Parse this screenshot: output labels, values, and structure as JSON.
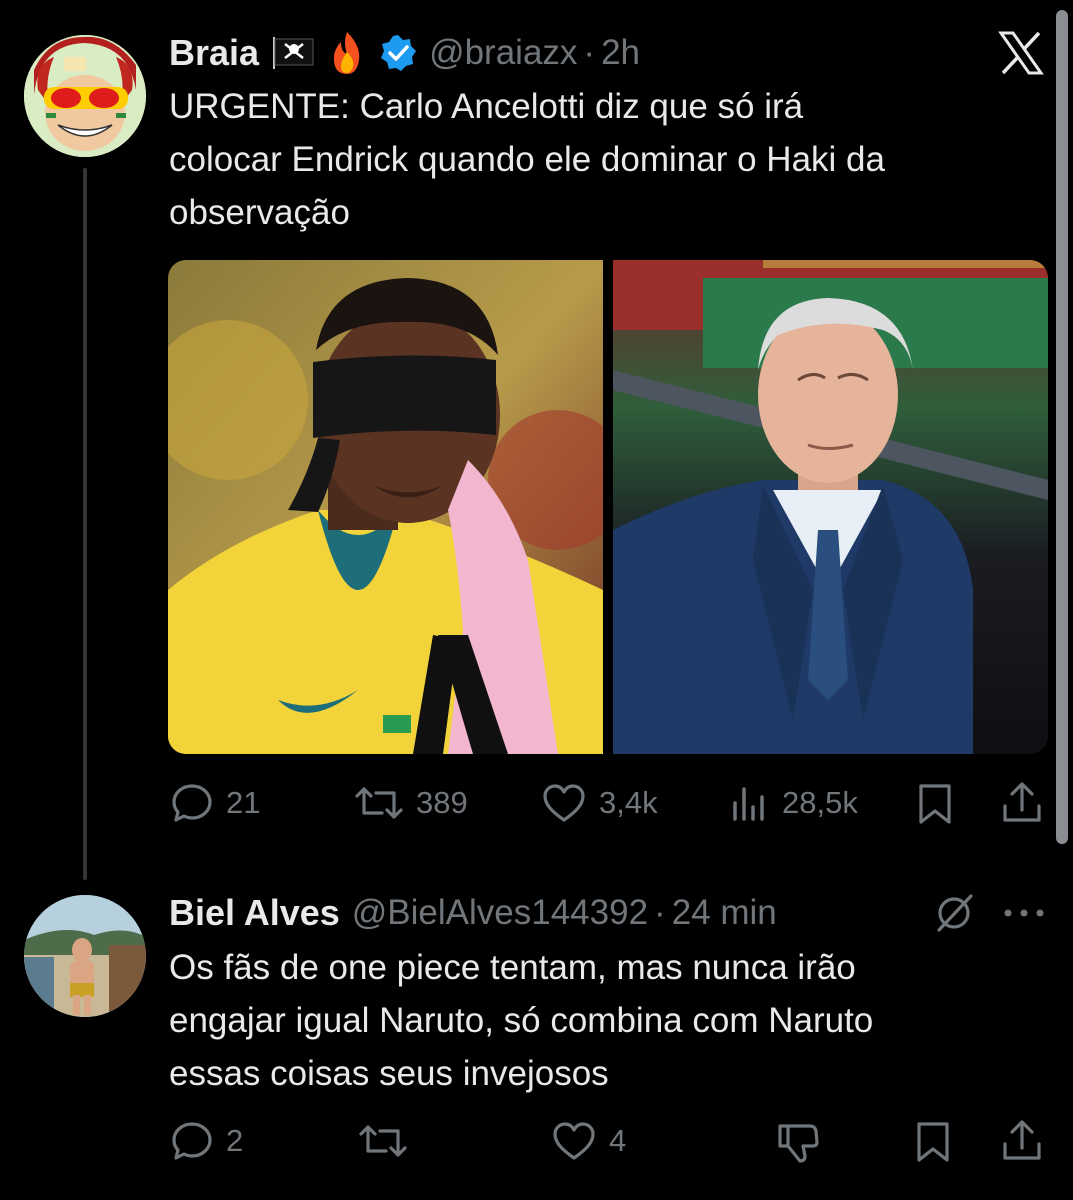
{
  "tweet": {
    "display_name": "Braia",
    "badges": [
      "pirate-flag-icon",
      "fire-icon",
      "verified-icon"
    ],
    "handle": "@braiazx",
    "dot": "·",
    "time": "2h",
    "text_lines": [
      "URGENTE: Carlo Ancelotti diz que só irá",
      "colocar Endrick quando ele dominar o Haki da",
      "observação"
    ],
    "media": [
      "image-endrick-blindfolded",
      "image-ancelotti"
    ],
    "stats": {
      "replies": "21",
      "reposts": "389",
      "likes": "3,4k",
      "views": "28,5k"
    }
  },
  "reply": {
    "display_name": "Biel Alves",
    "handle": "@BielAlves144392",
    "dot": "·",
    "time": "24 min",
    "text_lines": [
      "Os fãs de one piece tentam, mas nunca irão",
      "engajar igual Naruto, só combina com Naruto",
      "essas coisas seus invejosos"
    ],
    "stats": {
      "replies": "2",
      "likes": "4"
    }
  },
  "colors": {
    "background": "#000000",
    "text": "#e7e9ea",
    "muted": "#71767b",
    "verified": "#1d9bf0"
  }
}
